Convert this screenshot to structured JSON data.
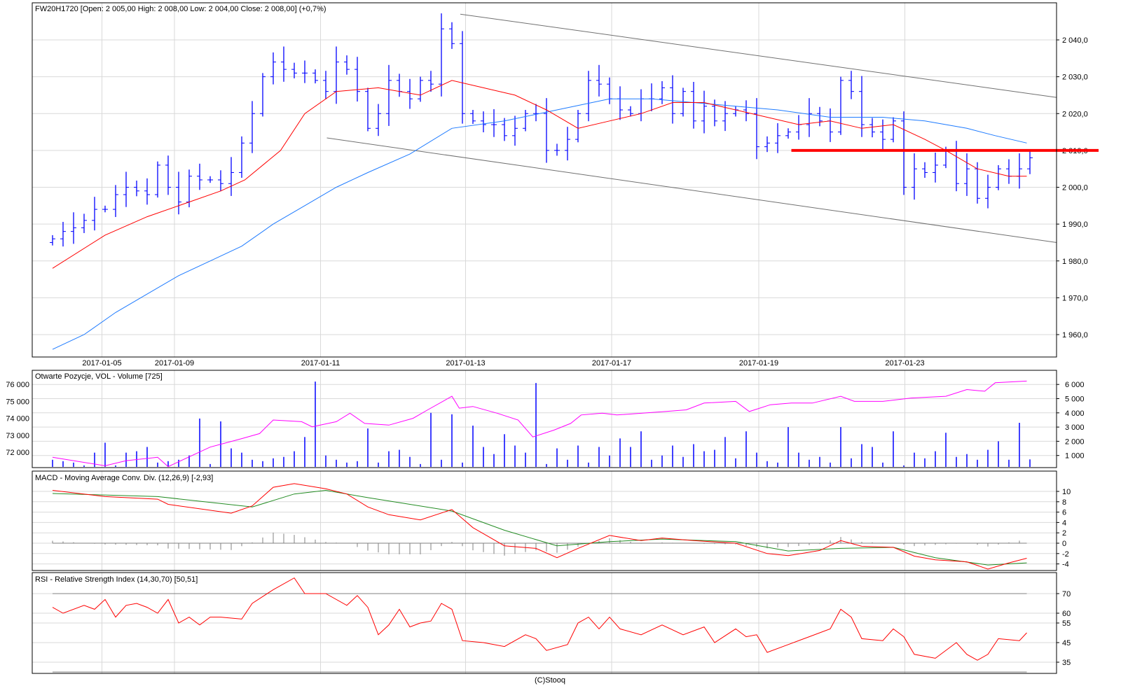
{
  "footer": "(C)Stooq",
  "colors": {
    "bars": "#0000ff",
    "ma_short": "#ff0000",
    "ma_long": "#1e7bff",
    "oi": "#ff00ff",
    "macd": "#ff0000",
    "signal": "#228b22",
    "hist": "#808080",
    "rsi": "#ff0000",
    "support": "#ff0000",
    "channel": "#707070",
    "grid": "#d9d9d9"
  },
  "chart_data": [
    {
      "type": "line",
      "panel": "price",
      "title": "FW20H1720 [Open: 2 005,00  High: 2 008,00  Low: 2 004,00  Close: 2 008,00] (+0,7%)",
      "x_ticks": [
        {
          "label": "2017-01-05",
          "bar": 4.7
        },
        {
          "label": "2017-01-09",
          "bar": 11.6
        },
        {
          "label": "2017-01-11",
          "bar": 25.5
        },
        {
          "label": "2017-01-13",
          "bar": 39.3
        },
        {
          "label": "2017-01-17",
          "bar": 53.2
        },
        {
          "label": "2017-01-19",
          "bar": 67.2
        },
        {
          "label": "2017-01-23",
          "bar": 81.1
        }
      ],
      "y_ticks": [
        {
          "v": 2040,
          "label": "2 040,0"
        },
        {
          "v": 2030,
          "label": "2 030,0"
        },
        {
          "v": 2020,
          "label": "2 020,0"
        },
        {
          "v": 2010,
          "label": "2 010,0"
        },
        {
          "v": 2000,
          "label": "2 000,0"
        },
        {
          "v": 1990,
          "label": "1 990,0"
        },
        {
          "v": 1980,
          "label": "1 980,0"
        },
        {
          "v": 1970,
          "label": "1 970,0"
        },
        {
          "v": 1960,
          "label": "1 960,0"
        }
      ],
      "ylim": [
        1950,
        2050
      ],
      "close": [
        1986,
        1988,
        1989,
        1991,
        1994,
        1994,
        1998,
        2000,
        1999,
        1998,
        2006,
        2000,
        1996,
        2003,
        2002,
        2002,
        2001,
        2004,
        2012,
        2020,
        2030,
        2034,
        2032,
        2031,
        2031,
        2029,
        2026,
        2034,
        2032,
        2026,
        2016,
        2020,
        2029,
        2026,
        2024,
        2029,
        2028,
        2043,
        2039,
        2020,
        2018,
        2017,
        2017,
        2014,
        2016,
        2020,
        2020,
        2010,
        2010,
        2013,
        2020,
        2029,
        2028,
        2024,
        2021,
        2020,
        2024,
        2024,
        2027,
        2020,
        2026,
        2018,
        2022,
        2018,
        2020,
        2021,
        2020,
        2011,
        2012,
        2014,
        2015,
        2017,
        2020,
        2018,
        2015,
        2029,
        2026,
        2017,
        2015,
        2013,
        2018,
        2000,
        2005,
        2004,
        2006,
        2010,
        2001,
        2005,
        1997,
        2000,
        2005,
        2003,
        2005,
        2008
      ],
      "ma_short": [
        [
          0,
          1978
        ],
        [
          5,
          1987
        ],
        [
          9,
          1992
        ],
        [
          13,
          1996
        ],
        [
          16,
          1999
        ],
        [
          18.3,
          2002
        ],
        [
          21.7,
          2010
        ],
        [
          24,
          2020
        ],
        [
          27,
          2026
        ],
        [
          31,
          2027
        ],
        [
          35,
          2025
        ],
        [
          38,
          2029
        ],
        [
          41,
          2027
        ],
        [
          44,
          2025
        ],
        [
          47,
          2021
        ],
        [
          50,
          2016
        ],
        [
          53,
          2018
        ],
        [
          56,
          2020
        ],
        [
          59,
          2023
        ],
        [
          62,
          2023
        ],
        [
          65,
          2021
        ],
        [
          68,
          2019
        ],
        [
          71,
          2017
        ],
        [
          74,
          2018
        ],
        [
          77,
          2016
        ],
        [
          80,
          2017
        ],
        [
          83,
          2013
        ],
        [
          85,
          2010
        ],
        [
          88,
          2005
        ],
        [
          91,
          2003
        ],
        [
          92.7,
          2003
        ]
      ],
      "ma_long": [
        [
          0,
          1956
        ],
        [
          3,
          1960
        ],
        [
          6,
          1966
        ],
        [
          9,
          1971
        ],
        [
          12,
          1976
        ],
        [
          15,
          1980
        ],
        [
          18,
          1984
        ],
        [
          21,
          1990
        ],
        [
          24,
          1995
        ],
        [
          27,
          2000
        ],
        [
          30,
          2004
        ],
        [
          34,
          2009
        ],
        [
          38,
          2016
        ],
        [
          43,
          2018
        ],
        [
          48,
          2021
        ],
        [
          53,
          2024
        ],
        [
          57,
          2024
        ],
        [
          61,
          2023
        ],
        [
          65,
          2022
        ],
        [
          69,
          2021
        ],
        [
          74,
          2019
        ],
        [
          79,
          2019
        ],
        [
          83,
          2018
        ],
        [
          87,
          2016
        ],
        [
          89.7,
          2014
        ],
        [
          92.7,
          2012
        ]
      ],
      "channel_upper": [
        [
          38.8,
          2047
        ],
        [
          95.5,
          2024.4
        ]
      ],
      "channel_lower": [
        [
          26.1,
          2013.4
        ],
        [
          95.5,
          1985
        ]
      ],
      "support_level": {
        "value": 2010,
        "from_bar": 70.3
      }
    },
    {
      "type": "bar",
      "panel": "volume",
      "title": "Otwarte Pozycje, VOL - Volume [725]",
      "left_ticks": [
        {
          "v": 76000,
          "label": "76 000"
        },
        {
          "v": 75000,
          "label": "75 000"
        },
        {
          "v": 74000,
          "label": "74 000"
        },
        {
          "v": 73000,
          "label": "73 000"
        },
        {
          "v": 72000,
          "label": "72 000"
        }
      ],
      "right_ticks": [
        {
          "v": 6000,
          "label": "6 000"
        },
        {
          "v": 5000,
          "label": "5 000"
        },
        {
          "v": 4000,
          "label": "4 000"
        },
        {
          "v": 3000,
          "label": "3 000"
        },
        {
          "v": 2000,
          "label": "2 000"
        },
        {
          "v": 1000,
          "label": "1 000"
        }
      ],
      "volume": [
        700,
        600,
        500,
        300,
        1200,
        1900,
        300,
        1200,
        1300,
        1600,
        500,
        600,
        700,
        1000,
        3600,
        400,
        3400,
        1500,
        1200,
        700,
        600,
        800,
        900,
        1300,
        2300,
        6200,
        1000,
        700,
        500,
        600,
        2900,
        500,
        1300,
        1400,
        900,
        400,
        4000,
        700,
        3900,
        500,
        3100,
        1600,
        1100,
        2500,
        1700,
        1200,
        6100,
        400,
        1500,
        700,
        1700,
        500,
        1600,
        1000,
        2200,
        1600,
        2700,
        700,
        1000,
        1700,
        900,
        1800,
        1300,
        1400,
        2300,
        800,
        2700,
        1200,
        600,
        500,
        3000,
        1200,
        700,
        900,
        500,
        3000,
        800,
        1800,
        1600,
        500,
        2700,
        300,
        1200,
        800,
        1300,
        2600,
        900,
        1100,
        700,
        1400,
        2000,
        700,
        3300,
        725
      ],
      "open_interest": [
        [
          0,
          71700
        ],
        [
          2,
          71500
        ],
        [
          5,
          71200
        ],
        [
          7,
          71500
        ],
        [
          10,
          71700
        ],
        [
          11,
          71150
        ],
        [
          15,
          72300
        ],
        [
          18,
          72800
        ],
        [
          19.7,
          73100
        ],
        [
          21,
          73900
        ],
        [
          23.7,
          73800
        ],
        [
          24.7,
          73500
        ],
        [
          27,
          73800
        ],
        [
          28.3,
          74300
        ],
        [
          29.7,
          73700
        ],
        [
          32,
          73600
        ],
        [
          34.3,
          74000
        ],
        [
          35.7,
          74500
        ],
        [
          38,
          75300
        ],
        [
          38.7,
          74600
        ],
        [
          40,
          74700
        ],
        [
          42.3,
          74300
        ],
        [
          44.3,
          73900
        ],
        [
          45.7,
          72900
        ],
        [
          47.7,
          73300
        ],
        [
          49.3,
          73700
        ],
        [
          50.3,
          74200
        ],
        [
          52.3,
          74300
        ],
        [
          53.7,
          74200
        ],
        [
          58.3,
          74400
        ],
        [
          60.3,
          74500
        ],
        [
          62,
          74900
        ],
        [
          65,
          75000
        ],
        [
          66.3,
          74400
        ],
        [
          68.3,
          74800
        ],
        [
          70.3,
          74900
        ],
        [
          72.3,
          74900
        ],
        [
          75,
          75300
        ],
        [
          76.3,
          75000
        ],
        [
          79,
          75000
        ],
        [
          81.7,
          75200
        ],
        [
          85,
          75300
        ],
        [
          87,
          75700
        ],
        [
          88.7,
          75600
        ],
        [
          89.7,
          76100
        ],
        [
          92.7,
          76200
        ]
      ]
    },
    {
      "type": "line",
      "panel": "macd",
      "title": "MACD - Moving Average Conv. Div. (12,26,9) [-2,93]",
      "y_ticks": [
        {
          "v": 10,
          "label": "10"
        },
        {
          "v": 8,
          "label": "8"
        },
        {
          "v": 6,
          "label": "6"
        },
        {
          "v": 4,
          "label": "4"
        },
        {
          "v": 2,
          "label": "2"
        },
        {
          "v": 0,
          "label": "0"
        },
        {
          "v": -2,
          "label": "-2"
        },
        {
          "v": -4,
          "label": "-4"
        }
      ],
      "macd": [
        [
          0,
          10.2
        ],
        [
          5,
          9
        ],
        [
          10,
          8.5
        ],
        [
          11,
          7.5
        ],
        [
          17,
          5.8
        ],
        [
          19,
          7.2
        ],
        [
          21,
          10.8
        ],
        [
          23,
          11.5
        ],
        [
          26,
          10.5
        ],
        [
          28,
          9.5
        ],
        [
          30,
          7
        ],
        [
          32,
          5.5
        ],
        [
          35,
          4.5
        ],
        [
          38,
          6.5
        ],
        [
          40,
          3
        ],
        [
          43,
          -0.5
        ],
        [
          46,
          -1
        ],
        [
          48,
          -2.8
        ],
        [
          50,
          -1
        ],
        [
          53,
          1.5
        ],
        [
          56,
          0.5
        ],
        [
          58,
          1
        ],
        [
          61,
          0.5
        ],
        [
          65,
          0
        ],
        [
          68,
          -2
        ],
        [
          70,
          -2.4
        ],
        [
          73,
          -1.4
        ],
        [
          75,
          0.5
        ],
        [
          77,
          -0.6
        ],
        [
          80,
          -0.8
        ],
        [
          82,
          -2.5
        ],
        [
          84,
          -3.2
        ],
        [
          87,
          -3.6
        ],
        [
          89,
          -5
        ],
        [
          91,
          -3.8
        ],
        [
          92.7,
          -2.9
        ]
      ],
      "signal": [
        [
          0,
          9.6
        ],
        [
          10,
          9
        ],
        [
          19,
          7
        ],
        [
          23,
          9.5
        ],
        [
          26,
          10.2
        ],
        [
          30,
          8.8
        ],
        [
          38,
          6.2
        ],
        [
          43,
          2.5
        ],
        [
          48,
          -0.5
        ],
        [
          53,
          0.3
        ],
        [
          58,
          0.8
        ],
        [
          65,
          0.3
        ],
        [
          70,
          -1.5
        ],
        [
          75,
          -1
        ],
        [
          80,
          -0.8
        ],
        [
          84,
          -2.8
        ],
        [
          89,
          -4.2
        ],
        [
          92.7,
          -3.8
        ]
      ]
    },
    {
      "type": "line",
      "panel": "rsi",
      "title": "RSI - Relative Strength Index (14,30,70) [50,51]",
      "y_ticks": [
        {
          "v": 70,
          "label": "70"
        },
        {
          "v": 60,
          "label": "60"
        },
        {
          "v": 55,
          "label": "55"
        },
        {
          "v": 45,
          "label": "45"
        },
        {
          "v": 35,
          "label": "35"
        }
      ],
      "levels": [
        30,
        70
      ],
      "rsi": [
        [
          0,
          63
        ],
        [
          1,
          60
        ],
        [
          3,
          64
        ],
        [
          4,
          62
        ],
        [
          5,
          67
        ],
        [
          6,
          58
        ],
        [
          7,
          64
        ],
        [
          8,
          65
        ],
        [
          9,
          63
        ],
        [
          10,
          60
        ],
        [
          11,
          67
        ],
        [
          12,
          55
        ],
        [
          13,
          58
        ],
        [
          14,
          54
        ],
        [
          15,
          58
        ],
        [
          16,
          58
        ],
        [
          18,
          57
        ],
        [
          19,
          65
        ],
        [
          21,
          72
        ],
        [
          23,
          78
        ],
        [
          24,
          70
        ],
        [
          26,
          70
        ],
        [
          28,
          64
        ],
        [
          29,
          69
        ],
        [
          30,
          63
        ],
        [
          31,
          49
        ],
        [
          32,
          54
        ],
        [
          33,
          62
        ],
        [
          34,
          53
        ],
        [
          35,
          55
        ],
        [
          36,
          56
        ],
        [
          37,
          65
        ],
        [
          38,
          62
        ],
        [
          39,
          46
        ],
        [
          41,
          45
        ],
        [
          43,
          43
        ],
        [
          45,
          49
        ],
        [
          46,
          47
        ],
        [
          47,
          41
        ],
        [
          49,
          44
        ],
        [
          50,
          55
        ],
        [
          51,
          58
        ],
        [
          52,
          52
        ],
        [
          53,
          58
        ],
        [
          54,
          52
        ],
        [
          56,
          49
        ],
        [
          58,
          54
        ],
        [
          60,
          49
        ],
        [
          62,
          53
        ],
        [
          63,
          45
        ],
        [
          65,
          52
        ],
        [
          66,
          48
        ],
        [
          67,
          49
        ],
        [
          68,
          40
        ],
        [
          70,
          44
        ],
        [
          72,
          48
        ],
        [
          74,
          52
        ],
        [
          75,
          62
        ],
        [
          76,
          58
        ],
        [
          77,
          47
        ],
        [
          79,
          46
        ],
        [
          80,
          52
        ],
        [
          81,
          48
        ],
        [
          82,
          39
        ],
        [
          84,
          37
        ],
        [
          86,
          45
        ],
        [
          87,
          39
        ],
        [
          88,
          36
        ],
        [
          89,
          39
        ],
        [
          90,
          47
        ],
        [
          92,
          46
        ],
        [
          92.7,
          50
        ]
      ]
    }
  ]
}
